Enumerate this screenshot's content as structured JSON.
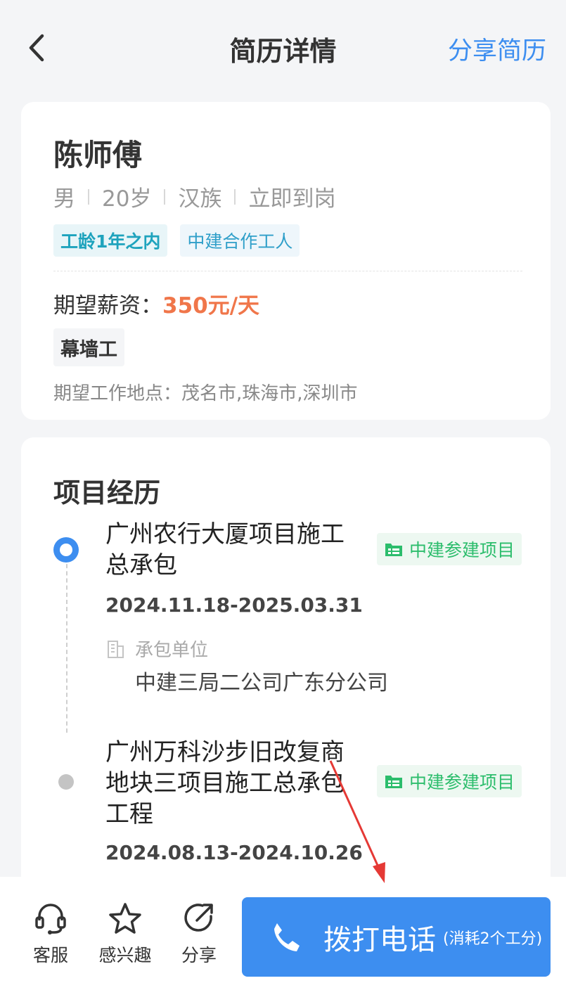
{
  "header": {
    "title": "简历详情",
    "share_label": "分享简历"
  },
  "profile": {
    "name": "陈师傅",
    "info": [
      "男",
      "20岁",
      "汉族",
      "立即到岗"
    ],
    "tags": [
      "工龄1年之内",
      "中建合作工人"
    ],
    "salary_label": "期望薪资：",
    "salary_value": "350元/天",
    "job_type": "幕墙工",
    "location": "期望工作地点：茂名市,珠海市,深圳市"
  },
  "projects": {
    "section_title": "项目经历",
    "items": [
      {
        "title": "广州农行大厦项目施工总承包",
        "badge": "中建参建项目",
        "date": "2024.11.18-2025.03.31",
        "contractor_label": "承包单位",
        "contractor": "中建三局二公司广东分公司"
      },
      {
        "title": "广州万科沙步旧改复商地块三项目施工总承包工程",
        "badge": "中建参建项目",
        "date": "2024.08.13-2024.10.26"
      }
    ]
  },
  "bottom_bar": {
    "service": "客服",
    "interest": "感兴趣",
    "share": "分享",
    "call_label": "拨打电话",
    "call_cost": "(消耗2个工分)"
  },
  "colors": {
    "accent": "#3d8ef0",
    "salary": "#f0764a",
    "badge_green": "#2cbd6c",
    "annotation_arrow": "#e53935"
  },
  "icons": [
    "back-chevron-icon",
    "timeline-dot-icon",
    "project-badge-icon",
    "building-icon",
    "headset-icon",
    "star-icon",
    "share-icon",
    "phone-icon"
  ]
}
